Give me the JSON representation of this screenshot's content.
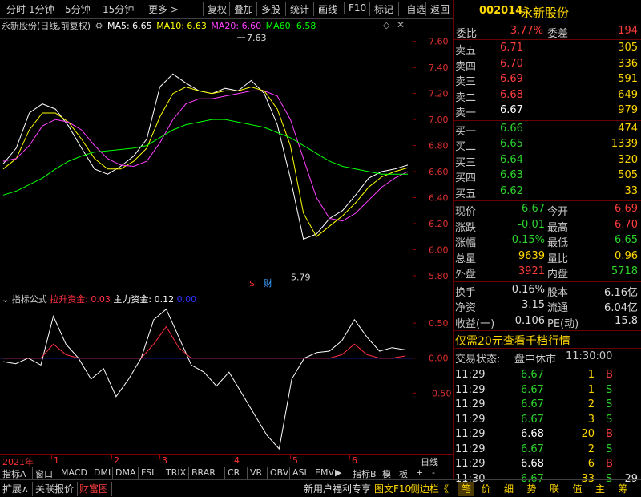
{
  "toolbar": {
    "items": [
      "分时",
      "1分钟",
      "5分钟",
      "15分钟",
      "更多 >",
      "复权",
      "叠加",
      "多股",
      "统计",
      "画线",
      "F10",
      "标记",
      "-自选",
      "返回"
    ]
  },
  "chart_header": {
    "name": "永新股份(日线,前复权)",
    "ma5": "MA5: 6.65",
    "ma10": "MA10: 6.63",
    "ma20": "MA20: 6.60",
    "ma60": "MA60: 6.58",
    "colors": {
      "ma5": "#ffffff",
      "ma10": "#ffff00",
      "ma20": "#ff40ff",
      "ma60": "#00ff00"
    }
  },
  "main_axis": {
    "labels": [
      "7.60",
      "7.40",
      "7.20",
      "7.00",
      "6.80",
      "6.60",
      "6.40",
      "6.20",
      "6.00",
      "5.80"
    ],
    "high_marker": "7.63",
    "low_marker": "5.79",
    "marker_s": "$",
    "marker_cai": "财"
  },
  "sub_header": {
    "name": "指标公式",
    "lift": "拉升资金: 0.03",
    "main": "主力资金: 0.12",
    "zero": "0.00"
  },
  "sub_axis": {
    "labels": [
      "0.50",
      "0.00",
      "-0.50"
    ]
  },
  "time_axis": {
    "year": "2021年",
    "months": [
      "1",
      "2",
      "3",
      "4",
      "5",
      "6"
    ],
    "unit": "日线"
  },
  "chart_data": [
    {
      "type": "line",
      "title": "",
      "ylim": [
        5.75,
        7.66
      ],
      "series": [
        {
          "name": "MA5",
          "color": "#ffffff",
          "values": [
            6.66,
            6.78,
            7.05,
            7.12,
            7.08,
            6.95,
            6.78,
            6.62,
            6.58,
            6.64,
            6.72,
            6.85,
            7.25,
            7.35,
            7.28,
            7.22,
            7.2,
            7.24,
            7.22,
            7.3,
            7.2,
            6.96,
            6.55,
            6.08,
            6.12,
            6.24,
            6.3,
            6.42,
            6.55,
            6.6,
            6.62,
            6.65
          ]
        },
        {
          "name": "MA10",
          "color": "#ffff00",
          "values": [
            6.62,
            6.7,
            6.92,
            7.05,
            7.05,
            6.98,
            6.85,
            6.7,
            6.62,
            6.62,
            6.68,
            6.78,
            7.02,
            7.2,
            7.25,
            7.22,
            7.2,
            7.22,
            7.22,
            7.25,
            7.22,
            7.08,
            6.8,
            6.28,
            6.1,
            6.18,
            6.26,
            6.36,
            6.48,
            6.56,
            6.6,
            6.63
          ]
        },
        {
          "name": "MA20",
          "color": "#ff40ff",
          "values": [
            6.68,
            6.7,
            6.8,
            6.95,
            7.0,
            6.98,
            6.92,
            6.8,
            6.7,
            6.65,
            6.64,
            6.68,
            6.82,
            7.0,
            7.12,
            7.16,
            7.16,
            7.18,
            7.2,
            7.22,
            7.22,
            7.18,
            7.0,
            6.7,
            6.4,
            6.24,
            6.22,
            6.28,
            6.38,
            6.48,
            6.55,
            6.6
          ]
        },
        {
          "name": "MA60",
          "color": "#00ff00",
          "values": [
            6.42,
            6.45,
            6.5,
            6.55,
            6.62,
            6.68,
            6.72,
            6.75,
            6.76,
            6.77,
            6.78,
            6.8,
            6.86,
            6.92,
            6.96,
            6.98,
            7.0,
            7.0,
            6.98,
            6.96,
            6.94,
            6.9,
            6.86,
            6.8,
            6.74,
            6.68,
            6.64,
            6.62,
            6.6,
            6.58,
            6.58,
            6.58
          ]
        }
      ]
    },
    {
      "type": "line",
      "title": "",
      "ylim": [
        -1.3,
        0.72
      ],
      "series": [
        {
          "name": "主力资金",
          "color": "#ffffff",
          "values": [
            -0.05,
            -0.08,
            0.0,
            -0.1,
            0.6,
            0.2,
            0.0,
            -0.3,
            -0.15,
            -0.55,
            -0.3,
            0.0,
            0.55,
            0.7,
            0.3,
            -0.1,
            -0.2,
            -0.4,
            -0.2,
            -0.5,
            -0.8,
            -1.1,
            -1.3,
            -0.3,
            0.0,
            0.08,
            0.1,
            0.25,
            0.55,
            0.3,
            0.1,
            0.15,
            0.12
          ]
        },
        {
          "name": "拉升资金",
          "color": "#ff3040",
          "values": [
            0,
            0,
            0,
            0,
            0.2,
            0.05,
            0,
            0,
            0,
            0,
            0,
            0,
            0.2,
            0.45,
            0.15,
            0,
            0,
            0,
            0,
            0,
            0,
            0,
            0,
            0,
            0,
            0,
            0,
            0.05,
            0.2,
            0.05,
            0,
            0,
            0.03
          ]
        }
      ]
    }
  ],
  "quote": {
    "code": "002014",
    "name": "永新股份",
    "weibi_label": "委比",
    "weibi": "3.77%",
    "weicha_label": "委差",
    "weicha": "194",
    "sell": [
      {
        "label": "卖五",
        "price": "6.71",
        "vol": "305"
      },
      {
        "label": "卖四",
        "price": "6.70",
        "vol": "336"
      },
      {
        "label": "卖三",
        "price": "6.69",
        "vol": "591"
      },
      {
        "label": "卖二",
        "price": "6.68",
        "vol": "649"
      },
      {
        "label": "卖一",
        "price": "6.67",
        "vol": "979"
      }
    ],
    "buy": [
      {
        "label": "买一",
        "price": "6.66",
        "vol": "474"
      },
      {
        "label": "买二",
        "price": "6.65",
        "vol": "1339"
      },
      {
        "label": "买三",
        "price": "6.64",
        "vol": "320"
      },
      {
        "label": "买四",
        "price": "6.63",
        "vol": "505"
      },
      {
        "label": "买五",
        "price": "6.62",
        "vol": "33"
      }
    ],
    "stats": [
      {
        "l1": "现价",
        "v1": "6.67",
        "c1": "green",
        "l2": "今开",
        "v2": "6.69",
        "c2": "red"
      },
      {
        "l1": "涨跌",
        "v1": "-0.01",
        "c1": "green",
        "l2": "最高",
        "v2": "6.70",
        "c2": "red"
      },
      {
        "l1": "涨幅",
        "v1": "-0.15%",
        "c1": "green",
        "l2": "最低",
        "v2": "6.65",
        "c2": "green"
      },
      {
        "l1": "总量",
        "v1": "9639",
        "c1": "yellow",
        "l2": "量比",
        "v2": "0.96",
        "c2": "yellow"
      },
      {
        "l1": "外盘",
        "v1": "3921",
        "c1": "red",
        "l2": "内盘",
        "v2": "5718",
        "c2": "green"
      }
    ],
    "stats2": [
      {
        "l1": "换手",
        "v1": "0.16%",
        "l2": "股本",
        "v2": "6.16亿"
      },
      {
        "l1": "净资",
        "v1": "3.15",
        "l2": "流通",
        "v2": "6.04亿"
      },
      {
        "l1": "收益(一)",
        "v1": "0.106",
        "l2": "PE(动)",
        "v2": "15.8"
      }
    ],
    "promo": "仅需20元查看千档行情",
    "status_label": "交易状态:",
    "status": "盘中休市",
    "status_time": "11:30:00",
    "ticks": [
      {
        "t": "11:29",
        "p": "6.67",
        "pc": "green",
        "v": "1",
        "d": "B",
        "dc": "red"
      },
      {
        "t": "11:29",
        "p": "6.67",
        "pc": "green",
        "v": "1",
        "d": "S",
        "dc": "green"
      },
      {
        "t": "11:29",
        "p": "6.67",
        "pc": "green",
        "v": "2",
        "d": "S",
        "dc": "green"
      },
      {
        "t": "11:29",
        "p": "6.67",
        "pc": "green",
        "v": "3",
        "d": "S",
        "dc": "green"
      },
      {
        "t": "11:29",
        "p": "6.68",
        "pc": "white",
        "v": "20",
        "d": "B",
        "dc": "red"
      },
      {
        "t": "11:29",
        "p": "6.67",
        "pc": "green",
        "v": "2",
        "d": "S",
        "dc": "green"
      },
      {
        "t": "11:29",
        "p": "6.68",
        "pc": "white",
        "v": "6",
        "d": "B",
        "dc": "red"
      },
      {
        "t": "11:30",
        "p": "6.67",
        "pc": "green",
        "v": "33",
        "d": "S",
        "dc": "green",
        "n": "29"
      }
    ]
  },
  "indicator_tabs": [
    "指标A",
    "窗口",
    "MACD",
    "DMI",
    "DMA",
    "FSL",
    "TRIX",
    "BRAR",
    "CR",
    "VR",
    "OBV",
    "ASI",
    "EMV",
    "指标B",
    "模",
    "板",
    "+",
    "-"
  ],
  "bottom_left": [
    "扩展∧",
    "关联报价",
    "财富图"
  ],
  "bottom_mid": [
    "新用户福利专享",
    "图文F10",
    "侧边栏《"
  ],
  "bottom_right": [
    "笔",
    "价",
    "细",
    "势",
    "联",
    "值",
    "主",
    "筹"
  ]
}
